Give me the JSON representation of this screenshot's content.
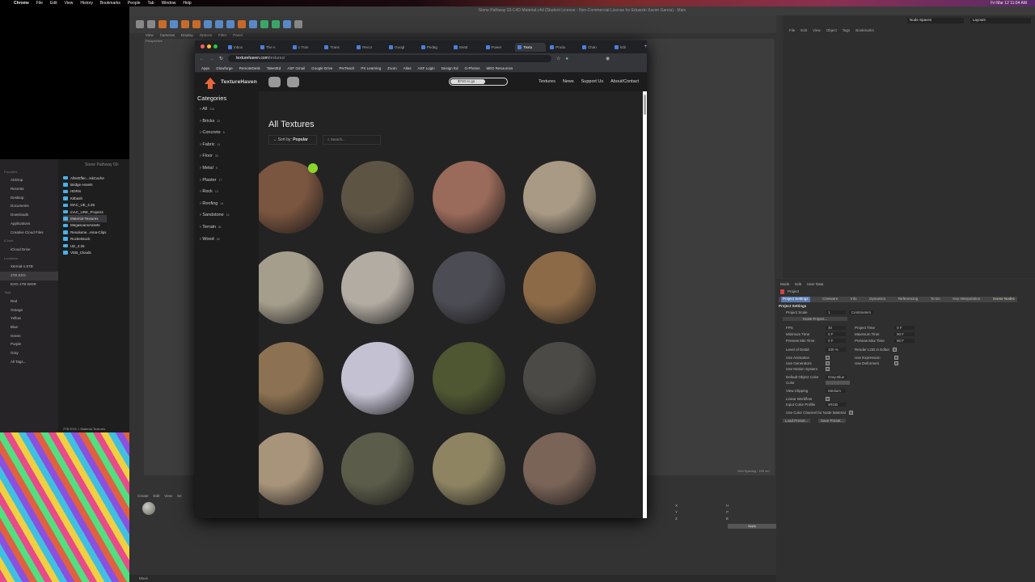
{
  "menubar": {
    "items": [
      "Chrome",
      "File",
      "Edit",
      "View",
      "History",
      "Bookmarks",
      "People",
      "Tab",
      "Window",
      "Help"
    ],
    "clock": "Fri Mar 12  11:04 AM"
  },
  "c4d": {
    "title": "Stone Pathway 03-C4D Material.c4d (Student License - Non-Commercial License for Eduardo Xavier Garcia) - Main",
    "viewport_menu": [
      "View",
      "Cameras",
      "Display",
      "Options",
      "Filter",
      "Panel"
    ],
    "viewport_label": "Perspective",
    "node_spaces": "Node Spaces",
    "layouts": "Layouts",
    "object_menu": [
      "File",
      "Edit",
      "View",
      "Object",
      "Tags",
      "Bookmarks"
    ],
    "material_menu": [
      "Create",
      "Edit",
      "View",
      "Se"
    ],
    "grid_spacing": "Grid Spacing : 100 cm",
    "status": "Move",
    "coords": [
      "X",
      "Y",
      "Z"
    ],
    "rot": [
      "H",
      "P",
      "B"
    ],
    "apply": "Apply"
  },
  "attributes": {
    "menu": [
      "Mode",
      "Edit",
      "User Data"
    ],
    "object": "Project",
    "tabs": [
      "Project Settings",
      "Cineware",
      "Info",
      "Dynamics",
      "Referencing",
      "To Do",
      "Key Interpolation",
      "Scene Nodes"
    ],
    "section": "Project Settings",
    "project_scale_label": "Project Scale",
    "project_scale": "1",
    "units": "Centimeters",
    "scale_project": "Scale Project...",
    "fps_label": "FPS",
    "fps": "30",
    "min_time_label": "Minimum Time",
    "min_time": "0 F",
    "prev_min_label": "Preview Min Time",
    "prev_min": "0 F",
    "proj_time_label": "Project Time",
    "proj_time": "0 F",
    "max_time_label": "Maximum Time",
    "max_time": "90 F",
    "prev_max_label": "Preview Max Time",
    "prev_max": "90 F",
    "lod_label": "Level of Detail",
    "lod": "100 %",
    "render_lod": "Render LOD in Editor",
    "use_animation": "Use Animation",
    "use_generators": "Use Generators",
    "use_motion": "Use Motion System",
    "use_expression": "Use Expression",
    "use_deformers": "Use Deformers",
    "def_color_label": "Default Object Color",
    "def_color": "Gray-Blue",
    "color_label": "Color",
    "view_clipping_label": "View Clipping",
    "view_clipping": "Medium",
    "linear_workflow": "Linear Workflow",
    "input_profile_label": "Input Color Profile",
    "input_profile": "sRGB",
    "use_color_channel": "Use Color Channel for Node Material",
    "load_preset": "Load Preset...",
    "save_preset": "Save Preset..."
  },
  "finder": {
    "title": "Stone Pathway 03-",
    "sections": [
      {
        "header": "Favorites",
        "items": [
          "AirDrop",
          "Recents",
          "Desktop",
          "Documents",
          "Downloads",
          "Applications",
          "Creative Cloud Files"
        ]
      },
      {
        "header": "iCloud",
        "items": [
          "iCloud Drive"
        ]
      },
      {
        "header": "Locations",
        "items": [
          "Xternal-1.5TB",
          "2TB EXG",
          "EXG-1TB-WOR"
        ]
      },
      {
        "header": "Tags",
        "items": [
          "Red",
          "Orange",
          "Yellow",
          "Blue",
          "Green",
          "Purple",
          "Gray",
          "All Tags..."
        ]
      }
    ],
    "folders": [
      "AfterEffec...iskCache",
      "Bridge Assets",
      "HDRIs",
      "Kitbash",
      "MAC_UE_4.26",
      "mAC_URE_Projects",
      "Material-Textures",
      "MegascansAssets",
      "Resolume...rena-Clips",
      "Rocketstock",
      "UE_4.26",
      "VDB_Clouds"
    ],
    "path": "2TB EXG > Material-Textures"
  },
  "browser": {
    "tabs": [
      "Inbox",
      "The A",
      "1 Tran",
      "Trans",
      "Recor",
      "Googl",
      "Pedag",
      "Seatt",
      "Power",
      "Textu",
      "Produ",
      "Chan",
      "hdri"
    ],
    "active_tab": 9,
    "url_host": "texturehaven.com",
    "url_path": "/textures/",
    "bookmarks": [
      "Apps",
      "Glowforge",
      "RemoteDesk",
      "TalentEd",
      "ASF Gmail",
      "Google Drive",
      "PerTeach",
      "PS Learning",
      "Zoom",
      "Atlas",
      "ASF Login",
      "Design Ed",
      "G-Photos",
      "MED Resources"
    ]
  },
  "site": {
    "logo": "TextureHaven",
    "goal_text": "$720 to go",
    "goal_progress": 0.62,
    "nav": [
      "Textures",
      "News",
      "Support Us",
      "About/Contact"
    ],
    "categories_title": "Categories",
    "categories": [
      {
        "name": "All",
        "count": "214"
      },
      {
        "name": "Bricks",
        "count": "22"
      },
      {
        "name": "Concrete",
        "count": "5"
      },
      {
        "name": "Fabric",
        "count": "11"
      },
      {
        "name": "Floor",
        "count": "30"
      },
      {
        "name": "Metal",
        "count": "5"
      },
      {
        "name": "Plaster",
        "count": "17"
      },
      {
        "name": "Rock",
        "count": "12"
      },
      {
        "name": "Roofing",
        "count": "14"
      },
      {
        "name": "Sandstone",
        "count": "14"
      },
      {
        "name": "Terrain",
        "count": "61"
      },
      {
        "name": "Wood",
        "count": "33"
      }
    ],
    "heading": "All Textures",
    "sort_label": "Sort by:",
    "sort_value": "Popular",
    "search_placeholder": "Search...",
    "textures": [
      {
        "color": "#7a5540",
        "new": true
      },
      {
        "color": "#5e5444"
      },
      {
        "color": "#9a6a5a"
      },
      {
        "color": "#a89a84"
      },
      {
        "color": "#a59e8c"
      },
      {
        "color": "#b2aca2"
      },
      {
        "color": "#4c4c54"
      },
      {
        "color": "#8c6a48"
      },
      {
        "color": "#8c7252"
      },
      {
        "color": "#c4c2d2"
      },
      {
        "color": "#4e5632"
      },
      {
        "color": "#4c4a46"
      },
      {
        "color": "#a8947a"
      },
      {
        "color": "#5c5c4a"
      },
      {
        "color": "#8e8462"
      },
      {
        "color": "#7a6458"
      }
    ]
  }
}
